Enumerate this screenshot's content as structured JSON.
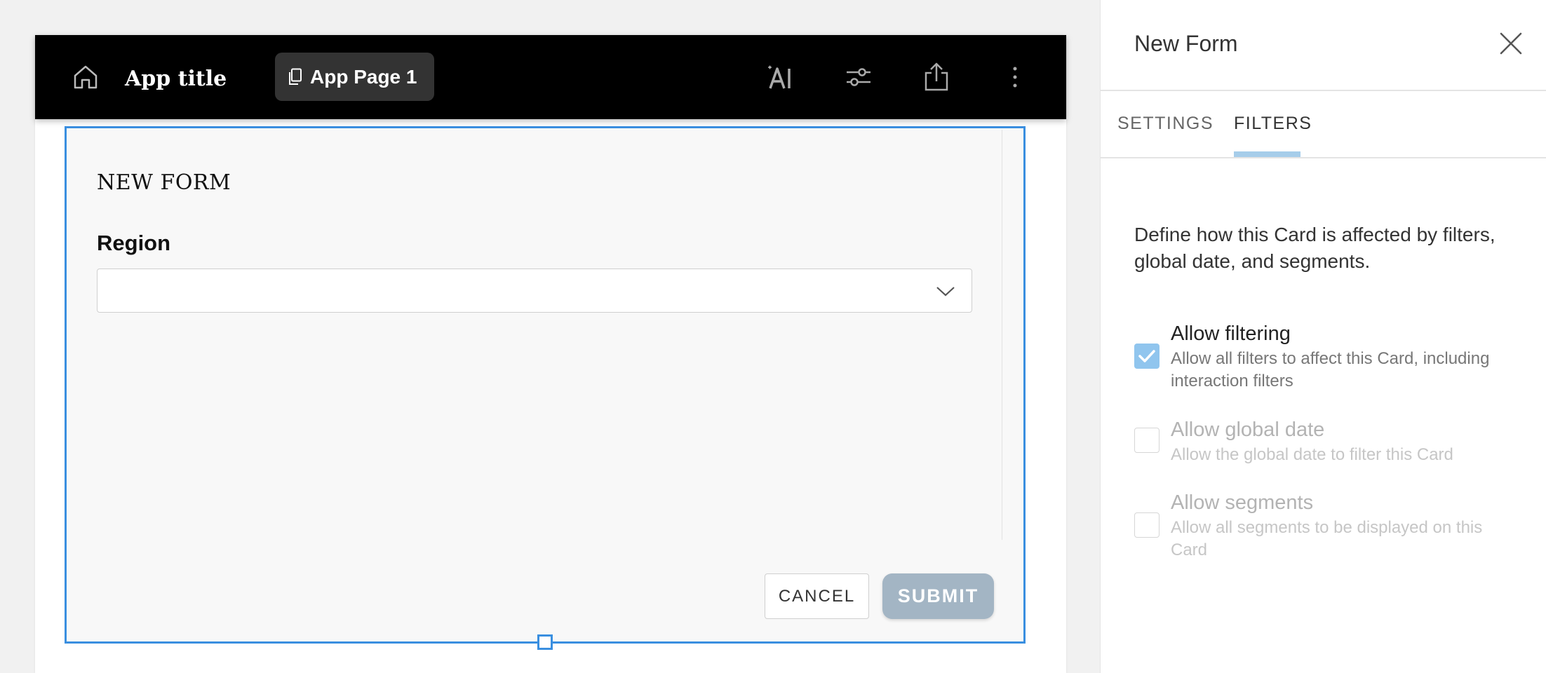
{
  "appbar": {
    "title": "App title",
    "page_tab": "App Page 1",
    "icons": [
      "home-icon",
      "page-copy-icon",
      "ai-sparkle-icon",
      "filter-sliders-icon",
      "share-icon",
      "more-vertical-icon"
    ]
  },
  "form": {
    "title": "NEW FORM",
    "field_label": "Region",
    "field_value": "",
    "cancel_label": "CANCEL",
    "submit_label": "SUBMIT"
  },
  "panel": {
    "title": "New Form",
    "tabs": [
      {
        "label": "SETTINGS",
        "active": false
      },
      {
        "label": "FILTERS",
        "active": true
      }
    ],
    "description": "Define how this Card is affected by filters, global date, and segments.",
    "options": [
      {
        "title": "Allow filtering",
        "subtitle": "Allow all filters to affect this Card, including interaction filters",
        "checked": true,
        "enabled": true
      },
      {
        "title": "Allow global date",
        "subtitle": "Allow the global date to filter this Card",
        "checked": false,
        "enabled": false
      },
      {
        "title": "Allow segments",
        "subtitle": "Allow all segments to be displayed on this Card",
        "checked": false,
        "enabled": false
      }
    ]
  },
  "colors": {
    "selection": "#3a8fe0",
    "checkbox_on": "#90c5ee",
    "tab_underline": "#a6cdea",
    "submit": "#a3b5c4",
    "appbar": "#000000"
  }
}
